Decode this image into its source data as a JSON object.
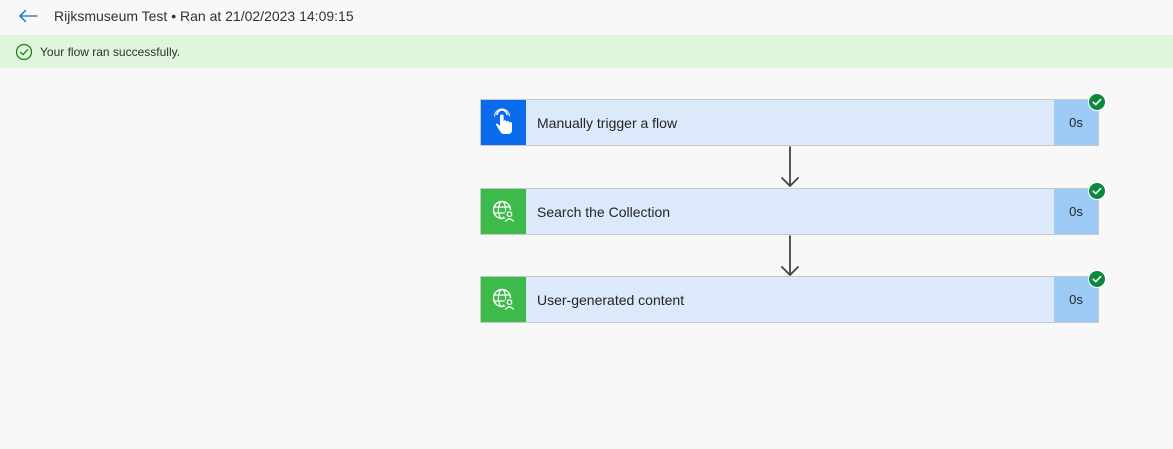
{
  "header": {
    "title": "Rijksmuseum Test • Ran at 21/02/2023 14:09:15",
    "back_icon": "arrow-left-icon"
  },
  "banner": {
    "message": "Your flow ran successfully.",
    "icon": "check-circle-icon",
    "color": "#dff6dd"
  },
  "flow": {
    "steps": [
      {
        "label": "Manually trigger a flow",
        "duration": "0s",
        "icon": "touch-hand-icon",
        "icon_bg": "#0a6ced",
        "status": "succeeded"
      },
      {
        "label": "Search the Collection",
        "duration": "0s",
        "icon": "globe-user-icon",
        "icon_bg": "#3dbb4a",
        "status": "succeeded"
      },
      {
        "label": "User-generated content",
        "duration": "0s",
        "icon": "globe-user-icon",
        "icon_bg": "#3dbb4a",
        "status": "succeeded"
      }
    ]
  },
  "colors": {
    "card_bg": "#dbe9fb",
    "duration_bg": "#9ecbf5",
    "success": "#0b8a3d"
  }
}
